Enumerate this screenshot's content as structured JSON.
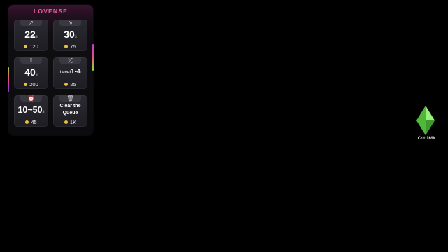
{
  "panel": {
    "brand": "LOVENSE",
    "cards": [
      {
        "icon": "rising-line-icon",
        "glyph": "↗",
        "value": "22",
        "unit": "s",
        "cost": "120"
      },
      {
        "icon": "wave-icon",
        "glyph": "∿",
        "value": "30",
        "unit": "s",
        "cost": "75"
      },
      {
        "icon": "pulse-icon",
        "glyph": "⎍",
        "value": "40",
        "unit": "s",
        "cost": "200"
      },
      {
        "icon": "shuffle-icon",
        "glyph": "⤮",
        "prefix": "Level",
        "value": "1-4",
        "cost": "25"
      },
      {
        "icon": "alarm-clock-icon",
        "glyph": "⏰",
        "value": "10~50",
        "unit": "s",
        "cost": "45"
      },
      {
        "icon": "trash-icon",
        "glyph": "🗑",
        "text": "Clear the Queue",
        "cost": "1K"
      }
    ]
  },
  "overlay": {
    "crit_label": "Crit:16%"
  },
  "colors": {
    "brand": "#e8609a",
    "coin": "#e7c23c",
    "diamond": "#6fdc4a"
  }
}
